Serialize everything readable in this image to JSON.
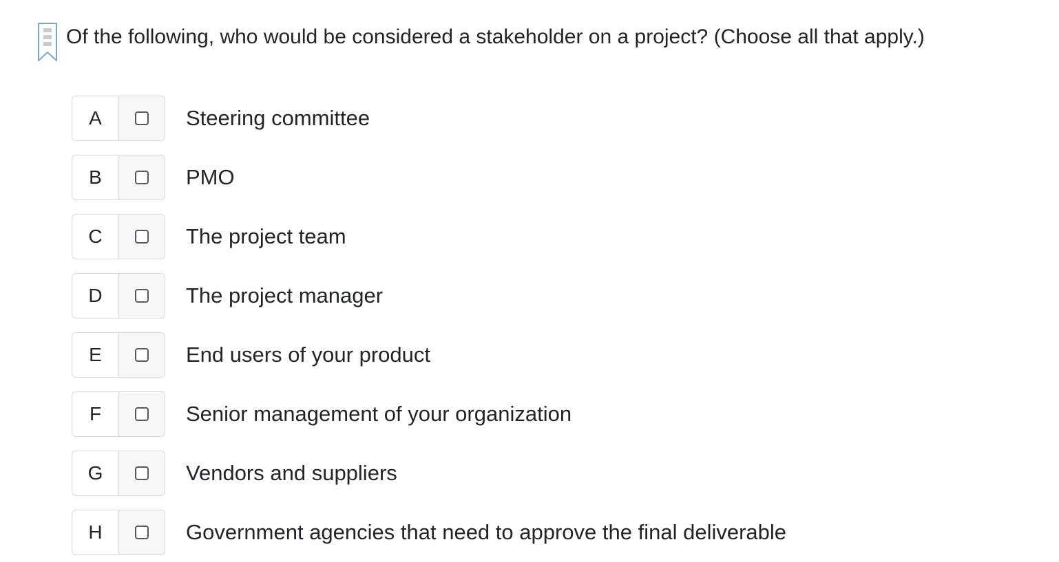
{
  "question": {
    "text": "Of the following, who would be considered a stakeholder on a project? (Choose all that apply.)"
  },
  "options": [
    {
      "letter": "A",
      "label": "Steering committee",
      "checked": false
    },
    {
      "letter": "B",
      "label": "PMO",
      "checked": false
    },
    {
      "letter": "C",
      "label": "The project team",
      "checked": false
    },
    {
      "letter": "D",
      "label": "The project manager",
      "checked": false
    },
    {
      "letter": "E",
      "label": "End users of your product",
      "checked": false
    },
    {
      "letter": "F",
      "label": "Senior management of your organization",
      "checked": false
    },
    {
      "letter": "G",
      "label": "Vendors and suppliers",
      "checked": false
    },
    {
      "letter": "H",
      "label": "Government agencies that need to approve the final deliverable",
      "checked": false
    }
  ],
  "icons": {
    "bookmark": "bookmark-icon",
    "checkbox": "checkbox-icon"
  },
  "colors": {
    "text": "#212529",
    "border": "#d5d8dc",
    "check_cell_bg": "#f6f7f8",
    "bookmark_stroke": "#7aa7c7"
  }
}
